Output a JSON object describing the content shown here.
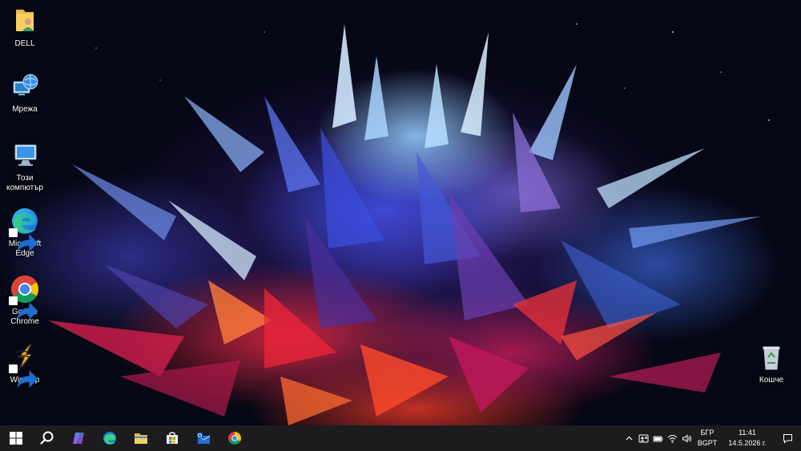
{
  "desktop": {
    "icons": [
      {
        "label": "DELL"
      },
      {
        "label": "Мрежа"
      },
      {
        "label": "Този компютър"
      },
      {
        "label": "Microsoft Edge"
      },
      {
        "label": "Google Chrome"
      },
      {
        "label": "Winamp"
      },
      {
        "label": "Кошче"
      }
    ]
  },
  "taskbar": {
    "pinned": [
      "windows-start-icon",
      "search-icon",
      "copilot-icon",
      "edge-icon",
      "file-explorer-icon",
      "microsoft-store-icon",
      "mail-icon",
      "chrome-icon"
    ],
    "tray": {
      "icons": [
        "chevron-up-icon",
        "meet-now-icon",
        "battery-icon",
        "wifi-icon",
        "volume-icon"
      ],
      "language": "БГР",
      "keyboard": "BGPT",
      "time": "11:41",
      "date": "14.5.2026 г."
    }
  },
  "colors": {
    "taskbar": "#1c1c1f",
    "accent": "#0078d4"
  }
}
